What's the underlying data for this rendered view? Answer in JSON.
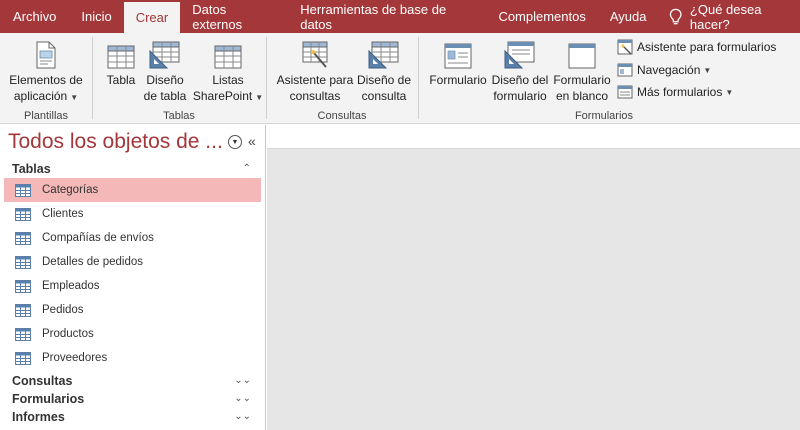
{
  "tabs": [
    {
      "label": "Archivo",
      "id": "file"
    },
    {
      "label": "Inicio",
      "id": "home"
    },
    {
      "label": "Crear",
      "id": "create"
    },
    {
      "label": "Datos externos",
      "id": "external"
    },
    {
      "label": "Herramientas de base de datos",
      "id": "dbtools"
    },
    {
      "label": "Complementos",
      "id": "addins"
    },
    {
      "label": "Ayuda",
      "id": "help"
    }
  ],
  "active_tab": "Crear",
  "tell_me": "¿Qué desea hacer?",
  "ribbon": {
    "plantillas": {
      "label": "Plantillas",
      "elementos_line1": "Elementos de",
      "elementos_line2": "aplicación"
    },
    "tablas": {
      "label": "Tablas",
      "tabla": "Tabla",
      "diseno_line1": "Diseño",
      "diseno_line2": "de tabla",
      "listas_line1": "Listas",
      "listas_line2": "SharePoint"
    },
    "consultas": {
      "label": "Consultas",
      "asistente_line1": "Asistente para",
      "asistente_line2": "consultas",
      "diseno_line1": "Diseño de",
      "diseno_line2": "consulta"
    },
    "formularios": {
      "label": "Formularios",
      "formulario": "Formulario",
      "diseno_line1": "Diseño del",
      "diseno_line2": "formulario",
      "blanco_line1": "Formulario",
      "blanco_line2": "en blanco",
      "asistente": "Asistente para formularios",
      "navegacion": "Navegación",
      "mas": "Más formularios"
    }
  },
  "nav": {
    "title": "Todos los objetos de ...",
    "sections": {
      "tablas": "Tablas",
      "consultas": "Consultas",
      "formularios": "Formularios",
      "informes": "Informes"
    },
    "tables": [
      "Categorías",
      "Clientes",
      "Compañías de envíos",
      "Detalles de pedidos",
      "Empleados",
      "Pedidos",
      "Productos",
      "Proveedores"
    ],
    "selected": "Categorías"
  },
  "colors": {
    "accent": "#a4373a",
    "selection": "#f5b8b8",
    "workspace": "#e6e6e6",
    "ribbon": "#f3f3f3"
  }
}
